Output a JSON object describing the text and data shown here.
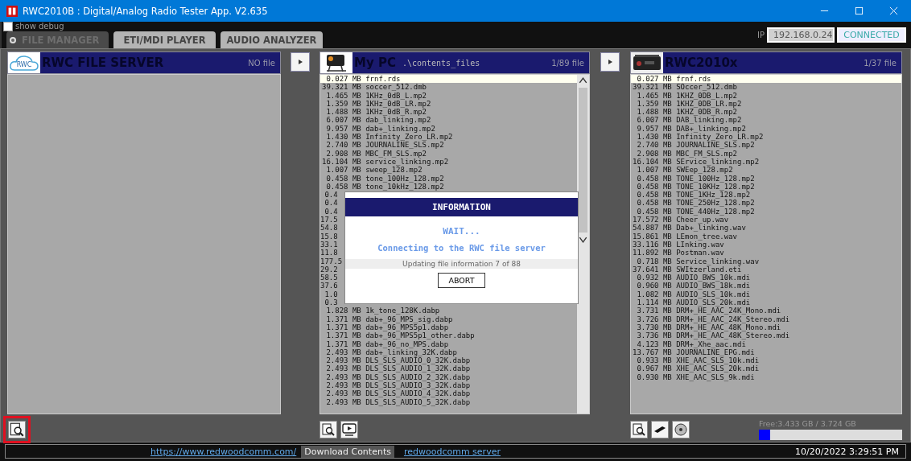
{
  "window": {
    "title": "RWC2010B : Digital/Analog Radio Tester App. V2.635"
  },
  "debug": {
    "label": "show debug",
    "checked": false
  },
  "tabs": [
    {
      "label": "FILE MANAGER",
      "selected": true
    },
    {
      "label": "ETI/MDI PLAYER",
      "selected": false
    },
    {
      "label": "AUDIO ANALYZER",
      "selected": false
    }
  ],
  "connection": {
    "ip_label": "IP",
    "ip": "192.168.0.24",
    "status": "CONNECTED"
  },
  "panels": [
    {
      "kind": "server",
      "title": "RWC FILE SERVER",
      "logo_text": "RWC",
      "count": "NO file",
      "tools": [
        {
          "kind": "search",
          "highlighted": true
        }
      ]
    },
    {
      "kind": "pc",
      "title": "My PC",
      "path": ".\\contents_files",
      "count": "1/89 file",
      "tools": [
        {
          "kind": "search",
          "highlighted": false
        },
        {
          "kind": "video",
          "highlighted": false
        }
      ],
      "rows": [
        {
          "kind": "file",
          "size": "0.027",
          "unit": "MB",
          "name": "frnf.rds",
          "selected": true
        },
        {
          "kind": "file",
          "size": "39.321",
          "unit": "MB",
          "name": "soccer_512.dmb",
          "selected": false
        },
        {
          "kind": "file",
          "size": "1.465",
          "unit": "MB",
          "name": "1KHz_0dB_L.mp2",
          "selected": false
        },
        {
          "kind": "file",
          "size": "1.359",
          "unit": "MB",
          "name": "1KHz_0dB_LR.mp2",
          "selected": false
        },
        {
          "kind": "file",
          "size": "1.488",
          "unit": "MB",
          "name": "1KHz_0dB_R.mp2",
          "selected": false
        },
        {
          "kind": "file",
          "size": "6.007",
          "unit": "MB",
          "name": "dab_linking.mp2",
          "selected": false
        },
        {
          "kind": "file",
          "size": "9.957",
          "unit": "MB",
          "name": "dab+_linking.mp2",
          "selected": false
        },
        {
          "kind": "file",
          "size": "1.430",
          "unit": "MB",
          "name": "Infinity_Zero_LR.mp2",
          "selected": false
        },
        {
          "kind": "file",
          "size": "2.740",
          "unit": "MB",
          "name": "JOURNALINE_SLS.mp2",
          "selected": false
        },
        {
          "kind": "file",
          "size": "2.908",
          "unit": "MB",
          "name": "MBC_FM_SLS.mp2",
          "selected": false
        },
        {
          "kind": "file",
          "size": "16.104",
          "unit": "MB",
          "name": "service_linking.mp2",
          "selected": false
        },
        {
          "kind": "file",
          "size": "1.007",
          "unit": "MB",
          "name": "sweep_128.mp2",
          "selected": false
        },
        {
          "kind": "file",
          "size": "0.458",
          "unit": "MB",
          "name": "tone_100Hz_128.mp2",
          "selected": false
        },
        {
          "kind": "file",
          "size": "0.458",
          "unit": "MB",
          "name": "tone_10kHz_128.mp2",
          "selected": false
        },
        {
          "kind": "cut",
          "text": "0.4",
          "selected": false
        },
        {
          "kind": "cut",
          "text": "0.4",
          "selected": false
        },
        {
          "kind": "cut",
          "text": "0.4",
          "selected": false
        },
        {
          "kind": "cut",
          "text": "17.5",
          "selected": false
        },
        {
          "kind": "cut",
          "text": "54.8",
          "selected": false
        },
        {
          "kind": "cut",
          "text": "15.8",
          "selected": false
        },
        {
          "kind": "cut",
          "text": "33.1",
          "selected": false
        },
        {
          "kind": "cut",
          "text": "11.8",
          "selected": false
        },
        {
          "kind": "cut",
          "text": "177.5",
          "selected": false
        },
        {
          "kind": "cut",
          "text": "29.2",
          "selected": false
        },
        {
          "kind": "cut",
          "text": "58.5",
          "selected": false
        },
        {
          "kind": "cut",
          "text": "37.6",
          "selected": false
        },
        {
          "kind": "cut",
          "text": "1.0",
          "selected": false
        },
        {
          "kind": "cut",
          "text": "0.3",
          "selected": false
        },
        {
          "kind": "file",
          "size": "1.828",
          "unit": "MB",
          "name": "1k_tone_128K.dabp",
          "selected": false
        },
        {
          "kind": "file",
          "size": "1.371",
          "unit": "MB",
          "name": "dab+_96_MPS_sig.dabp",
          "selected": false
        },
        {
          "kind": "file",
          "size": "1.371",
          "unit": "MB",
          "name": "dab+_96_MPS5p1.dabp",
          "selected": false
        },
        {
          "kind": "file",
          "size": "1.371",
          "unit": "MB",
          "name": "dab+_96_MPS5p1_other.dabp",
          "selected": false
        },
        {
          "kind": "file",
          "size": "1.371",
          "unit": "MB",
          "name": "dab+_96_no_MPS.dabp",
          "selected": false
        },
        {
          "kind": "file",
          "size": "2.493",
          "unit": "MB",
          "name": "dab+_linking_32K.dabp",
          "selected": false
        },
        {
          "kind": "file",
          "size": "2.493",
          "unit": "MB",
          "name": "DLS_SLS_AUDIO_0_32K.dabp",
          "selected": false
        },
        {
          "kind": "file",
          "size": "2.493",
          "unit": "MB",
          "name": "DLS_SLS_AUDIO_1_32K.dabp",
          "selected": false
        },
        {
          "kind": "file",
          "size": "2.493",
          "unit": "MB",
          "name": "DLS_SLS_AUDIO_2_32K.dabp",
          "selected": false
        },
        {
          "kind": "file",
          "size": "2.493",
          "unit": "MB",
          "name": "DLS_SLS_AUDIO_3_32K.dabp",
          "selected": false
        },
        {
          "kind": "file",
          "size": "2.493",
          "unit": "MB",
          "name": "DLS_SLS_AUDIO_4_32K.dabp",
          "selected": false
        },
        {
          "kind": "file",
          "size": "2.493",
          "unit": "MB",
          "name": "DLS_SLS_AUDIO_5_32K.dabp",
          "selected": false
        }
      ]
    },
    {
      "kind": "device",
      "title": "RWC2010x",
      "count": "1/37 file",
      "tools": [
        {
          "kind": "search",
          "highlighted": false
        },
        {
          "kind": "device",
          "highlighted": false
        },
        {
          "kind": "disk",
          "highlighted": false
        }
      ],
      "rows": [
        {
          "kind": "file",
          "size": "0.027",
          "unit": "MB",
          "name": "frnf.rds",
          "selected": true
        },
        {
          "kind": "file",
          "size": "39.321",
          "unit": "MB",
          "name": "SOccer_512.dmb",
          "selected": false
        },
        {
          "kind": "file",
          "size": "1.465",
          "unit": "MB",
          "name": "1KHZ_0DB_L.mp2",
          "selected": false
        },
        {
          "kind": "file",
          "size": "1.359",
          "unit": "MB",
          "name": "1KHZ_0DB_LR.mp2",
          "selected": false
        },
        {
          "kind": "file",
          "size": "1.488",
          "unit": "MB",
          "name": "1KHZ_0DB_R.mp2",
          "selected": false
        },
        {
          "kind": "file",
          "size": "6.007",
          "unit": "MB",
          "name": "DAB_linking.mp2",
          "selected": false
        },
        {
          "kind": "file",
          "size": "9.957",
          "unit": "MB",
          "name": "DAB+_linking.mp2",
          "selected": false
        },
        {
          "kind": "file",
          "size": "1.430",
          "unit": "MB",
          "name": "Infinity_Zero_LR.mp2",
          "selected": false
        },
        {
          "kind": "file",
          "size": "2.740",
          "unit": "MB",
          "name": "JOURNALINE_SLS.mp2",
          "selected": false
        },
        {
          "kind": "file",
          "size": "2.908",
          "unit": "MB",
          "name": "MBC_FM_SLS.mp2",
          "selected": false
        },
        {
          "kind": "file",
          "size": "16.104",
          "unit": "MB",
          "name": "SErvice_linking.mp2",
          "selected": false
        },
        {
          "kind": "file",
          "size": "1.007",
          "unit": "MB",
          "name": "SWEep_128.mp2",
          "selected": false
        },
        {
          "kind": "file",
          "size": "0.458",
          "unit": "MB",
          "name": "TONE_100Hz_128.mp2",
          "selected": false
        },
        {
          "kind": "file",
          "size": "0.458",
          "unit": "MB",
          "name": "TONE_10KHz_128.mp2",
          "selected": false
        },
        {
          "kind": "file",
          "size": "0.458",
          "unit": "MB",
          "name": "TONE_1KHz_128.mp2",
          "selected": false
        },
        {
          "kind": "file",
          "size": "0.458",
          "unit": "MB",
          "name": "TONE_250Hz_128.mp2",
          "selected": false
        },
        {
          "kind": "file",
          "size": "0.458",
          "unit": "MB",
          "name": "TONE_440Hz_128.mp2",
          "selected": false
        },
        {
          "kind": "file",
          "size": "17.572",
          "unit": "MB",
          "name": "Cheer_up.wav",
          "selected": false
        },
        {
          "kind": "file",
          "size": "54.887",
          "unit": "MB",
          "name": "Dab+_linking.wav",
          "selected": false
        },
        {
          "kind": "file",
          "size": "15.861",
          "unit": "MB",
          "name": "LEmon_tree.wav",
          "selected": false
        },
        {
          "kind": "file",
          "size": "33.116",
          "unit": "MB",
          "name": "LInking.wav",
          "selected": false
        },
        {
          "kind": "file",
          "size": "11.892",
          "unit": "MB",
          "name": "Postman.wav",
          "selected": false
        },
        {
          "kind": "file",
          "size": "0.718",
          "unit": "MB",
          "name": "Service_linking.wav",
          "selected": false
        },
        {
          "kind": "file",
          "size": "37.641",
          "unit": "MB",
          "name": "SWItzerland.eti",
          "selected": false
        },
        {
          "kind": "file",
          "size": "0.932",
          "unit": "MB",
          "name": "AUDIO_BWS_10k.mdi",
          "selected": false
        },
        {
          "kind": "file",
          "size": "0.960",
          "unit": "MB",
          "name": "AUDIO_BWS_18k.mdi",
          "selected": false
        },
        {
          "kind": "file",
          "size": "1.082",
          "unit": "MB",
          "name": "AUDIO_SLS_10k.mdi",
          "selected": false
        },
        {
          "kind": "file",
          "size": "1.114",
          "unit": "MB",
          "name": "AUDIO_SLS_20k.mdi",
          "selected": false
        },
        {
          "kind": "file",
          "size": "3.731",
          "unit": "MB",
          "name": "DRM+_HE_AAC_24K_Mono.mdi",
          "selected": false
        },
        {
          "kind": "file",
          "size": "3.726",
          "unit": "MB",
          "name": "DRM+_HE_AAC_24K_Stereo.mdi",
          "selected": false
        },
        {
          "kind": "file",
          "size": "3.730",
          "unit": "MB",
          "name": "DRM+_HE_AAC_48K_Mono.mdi",
          "selected": false
        },
        {
          "kind": "file",
          "size": "3.736",
          "unit": "MB",
          "name": "DRM+_HE_AAC_48K_Stereo.mdi",
          "selected": false
        },
        {
          "kind": "file",
          "size": "4.123",
          "unit": "MB",
          "name": "DRM+_Xhe_aac.mdi",
          "selected": false
        },
        {
          "kind": "file",
          "size": "13.767",
          "unit": "MB",
          "name": "JOURNALINE_EPG.mdi",
          "selected": false
        },
        {
          "kind": "file",
          "size": "0.933",
          "unit": "MB",
          "name": "XHE_AAC_SLS_10k.mdi",
          "selected": false
        },
        {
          "kind": "file",
          "size": "0.967",
          "unit": "MB",
          "name": "XHE_AAC_SLS_20k.mdi",
          "selected": false
        },
        {
          "kind": "file",
          "size": "0.930",
          "unit": "MB",
          "name": "XHE_AAC_SLS_9k.mdi",
          "selected": false
        }
      ]
    }
  ],
  "storage": {
    "free": "Free:3.433 GB / 3.724 GB",
    "level": 0.08
  },
  "dialog": {
    "title": "INFORMATION",
    "heading": "WAIT...",
    "message": "Connecting to the RWC file server",
    "progress": "Updating file information 7 of 88",
    "button": "ABORT"
  },
  "status_bar": {
    "link": "https://www.redwoodcomm.com/",
    "download": "Download Contents",
    "server_link": "redwoodcomm server",
    "datetime": "10/20/2022 3:29:51 PM"
  }
}
